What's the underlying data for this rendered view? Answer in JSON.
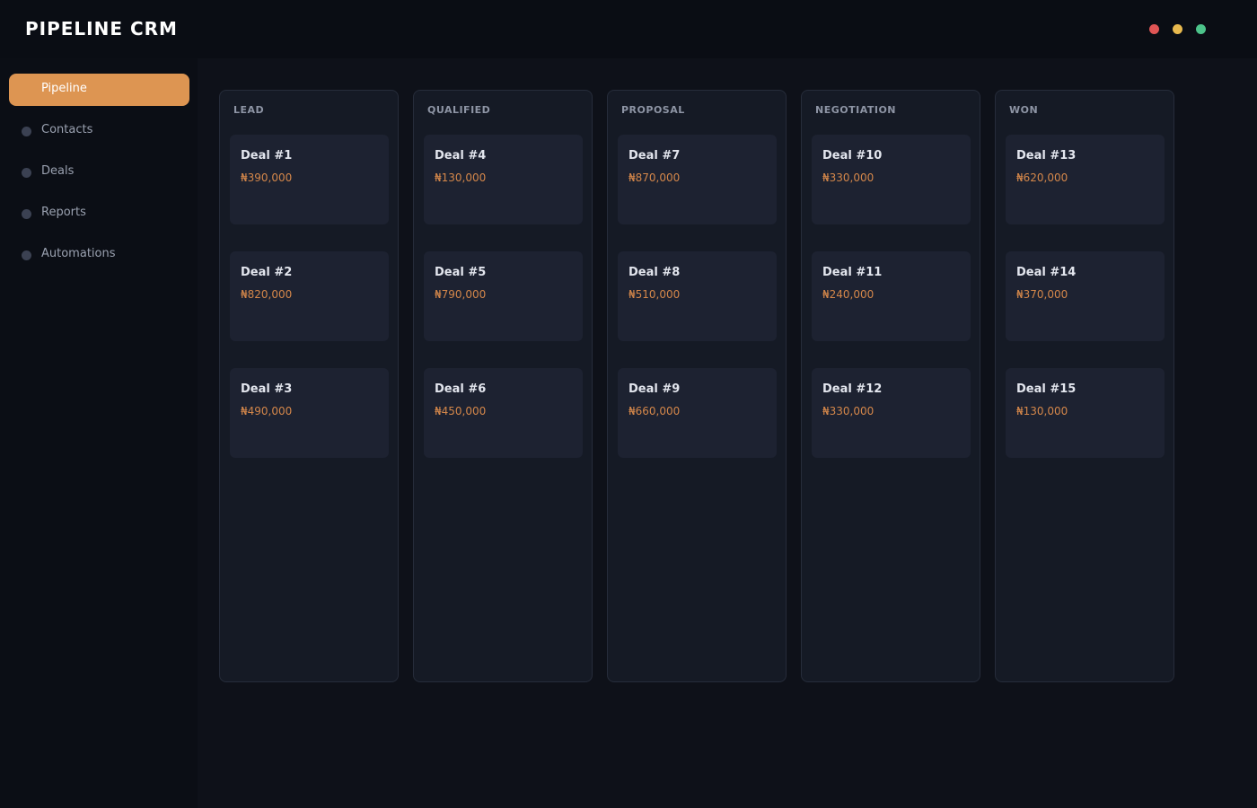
{
  "app": {
    "title": "PIPELINE CRM",
    "window_controls": [
      {
        "name": "close-dot",
        "color": "#e05555"
      },
      {
        "name": "minimize-dot",
        "color": "#e8b94e"
      },
      {
        "name": "maximize-dot",
        "color": "#4cc38a"
      }
    ]
  },
  "sidebar": {
    "items": [
      {
        "label": "Pipeline",
        "active": true
      },
      {
        "label": "Contacts",
        "active": false
      },
      {
        "label": "Deals",
        "active": false
      },
      {
        "label": "Reports",
        "active": false
      },
      {
        "label": "Automations",
        "active": false
      }
    ]
  },
  "board": {
    "columns": [
      {
        "title": "LEAD",
        "cards": [
          {
            "name": "Deal #1",
            "value": "₦390,000"
          },
          {
            "name": "Deal #2",
            "value": "₦820,000"
          },
          {
            "name": "Deal #3",
            "value": "₦490,000"
          }
        ]
      },
      {
        "title": "QUALIFIED",
        "cards": [
          {
            "name": "Deal #4",
            "value": "₦130,000"
          },
          {
            "name": "Deal #5",
            "value": "₦790,000"
          },
          {
            "name": "Deal #6",
            "value": "₦450,000"
          }
        ]
      },
      {
        "title": "PROPOSAL",
        "cards": [
          {
            "name": "Deal #7",
            "value": "₦870,000"
          },
          {
            "name": "Deal #8",
            "value": "₦510,000"
          },
          {
            "name": "Deal #9",
            "value": "₦660,000"
          }
        ]
      },
      {
        "title": "NEGOTIATION",
        "cards": [
          {
            "name": "Deal #10",
            "value": "₦330,000"
          },
          {
            "name": "Deal #11",
            "value": "₦240,000"
          },
          {
            "name": "Deal #12",
            "value": "₦330,000"
          }
        ]
      },
      {
        "title": "WON",
        "cards": [
          {
            "name": "Deal #13",
            "value": "₦620,000"
          },
          {
            "name": "Deal #14",
            "value": "₦370,000"
          },
          {
            "name": "Deal #15",
            "value": "₦130,000"
          }
        ]
      }
    ]
  },
  "colors": {
    "accent": "#dd9552",
    "deal_value": "#d4874a"
  }
}
